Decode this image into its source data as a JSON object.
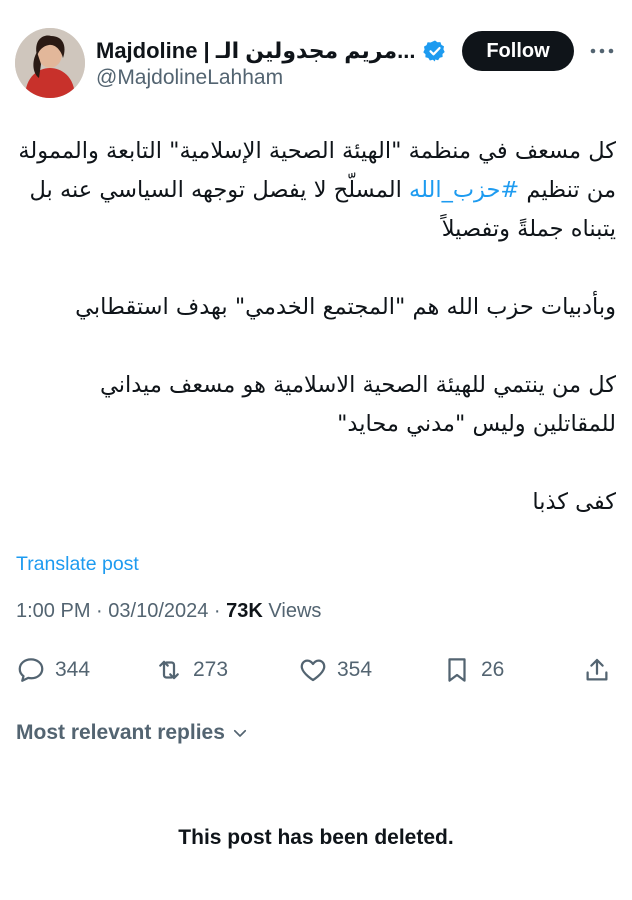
{
  "author": {
    "display_name": "Majdoline | مريم مجدولين الـ...",
    "handle": "@MajdolineLahham",
    "verified_badge_color": "#1d9bf0",
    "avatar_icon": "profile-photo"
  },
  "follow_button": {
    "label": "Follow"
  },
  "more_icon": "more-horizontal-icon",
  "tweet": {
    "p1_before_hashtag": "كل مسعف في منظمة \"الهيئة الصحية الإسلامية\" التابعة والممولة من تنظيم ",
    "hashtag": "#حزب_الله",
    "p1_after_hashtag": " المسلّح لا يفصل توجهه السياسي عنه بل يتبناه جملةً وتفصيلاً",
    "p2": "وبأدبيات حزب الله هم \"المجتمع الخدمي\" بهدف استقطابي",
    "p3": "كل من ينتمي للهيئة الصحية الاسلامية هو مسعف ميداني للمقاتلين وليس \"مدني محايد\"",
    "p4": "كفى كذبا"
  },
  "translate_label": "Translate post",
  "meta": {
    "time": "1:00 PM",
    "separator": " · ",
    "date": "03/10/2024",
    "views_count": "73K",
    "views_label": " Views"
  },
  "actions": {
    "replies": "344",
    "reposts": "273",
    "likes": "354",
    "bookmarks": "26"
  },
  "replies_filter": {
    "label": "Most relevant replies"
  },
  "deleted_notice": "This post has been deleted.",
  "colors": {
    "accent": "#1d9bf0",
    "text_primary": "#0f1419",
    "text_secondary": "#536471",
    "follow_bg": "#0f1419"
  }
}
